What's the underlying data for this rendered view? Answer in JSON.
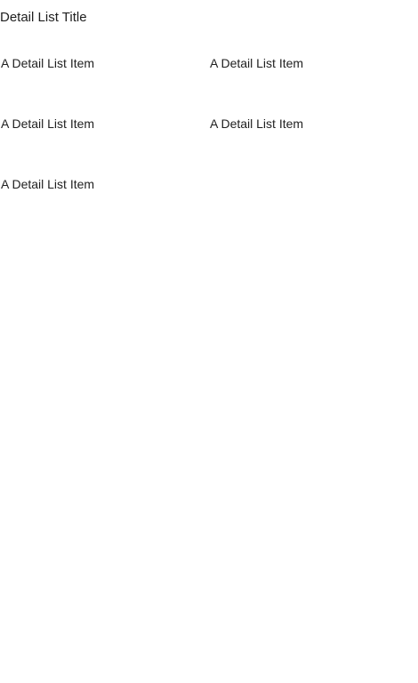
{
  "detail_list": {
    "title": "Detail List Title",
    "items": [
      {
        "label": "A Detail List Item"
      },
      {
        "label": "A Detail List Item"
      },
      {
        "label": "A Detail List Item"
      },
      {
        "label": "A Detail List Item"
      },
      {
        "label": "A Detail List Item"
      }
    ]
  }
}
